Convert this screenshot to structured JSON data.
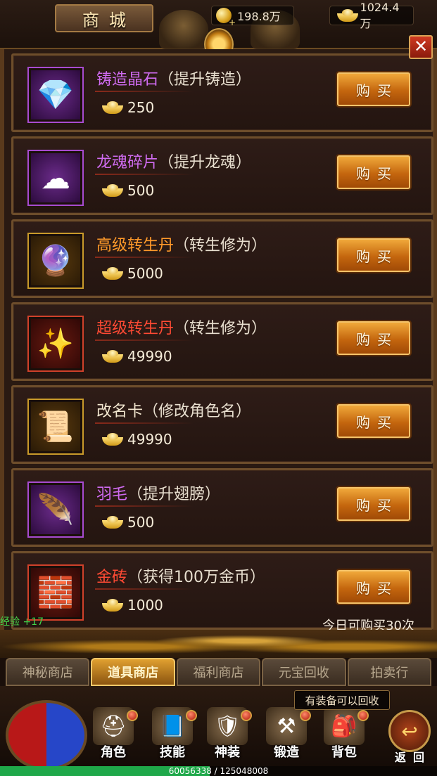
{
  "header": {
    "title": "商城",
    "gold_coins": "198.8万",
    "ingots": "1024.4万",
    "close_label": "✕"
  },
  "items": [
    {
      "name": "铸造晶石",
      "desc": "（提升铸造）",
      "price": "250",
      "buy_label": "购买",
      "name_color": "#cf6bf0",
      "icon": "crystal-icon",
      "glyph": "💎"
    },
    {
      "name": "龙魂碎片",
      "desc": "（提升龙魂）",
      "price": "500",
      "buy_label": "购买",
      "name_color": "#cf6bf0",
      "icon": "dragon-soul-icon",
      "glyph": "☁"
    },
    {
      "name": "高级转生丹",
      "desc": "（转生修为）",
      "price": "5000",
      "buy_label": "购买",
      "name_color": "#ff9a2a",
      "icon": "purple-pill-icon",
      "glyph": "🔮"
    },
    {
      "name": "超级转生丹",
      "desc": "（转生修为）",
      "price": "49990",
      "buy_label": "购买",
      "name_color": "#ff4a34",
      "icon": "super-pill-icon",
      "glyph": "✨"
    },
    {
      "name": "改名卡",
      "desc": "（修改角色名）",
      "price": "49990",
      "buy_label": "购买",
      "name_color": "#f3e7d0",
      "icon": "rename-card-icon",
      "glyph": "📜"
    },
    {
      "name": "羽毛",
      "desc": "（提升翅膀）",
      "price": "500",
      "buy_label": "购买",
      "name_color": "#cf6bf0",
      "icon": "feather-icon",
      "glyph": "🪶"
    },
    {
      "name": "金砖",
      "desc": "（获得100万金币）",
      "price": "1000",
      "buy_label": "购买",
      "name_color": "#ff4a34",
      "icon": "gold-brick-icon",
      "glyph": "🧱"
    }
  ],
  "daily_limit": "今日可购买30次",
  "exp_gain": "经验 +17",
  "tabs": [
    {
      "label": "神秘商店",
      "active": false
    },
    {
      "label": "道具商店",
      "active": true
    },
    {
      "label": "福利商店",
      "active": false
    },
    {
      "label": "元宝回收",
      "active": false
    },
    {
      "label": "拍卖行",
      "active": false
    }
  ],
  "tooltip": "有装备可以回收",
  "hud": {
    "buttons": [
      {
        "label": "角色",
        "icon": "helmet-icon",
        "glyph": "⛑"
      },
      {
        "label": "技能",
        "icon": "skill-book-icon",
        "glyph": "📘"
      },
      {
        "label": "神装",
        "icon": "divine-armor-icon",
        "glyph": "🛡"
      },
      {
        "label": "锻造",
        "icon": "forge-icon",
        "glyph": "⚒"
      },
      {
        "label": "背包",
        "icon": "backpack-icon",
        "glyph": "🎒"
      }
    ],
    "return_label": "返回",
    "exp_text": "60056338 / 125048008",
    "exp_fraction": 0.48
  }
}
